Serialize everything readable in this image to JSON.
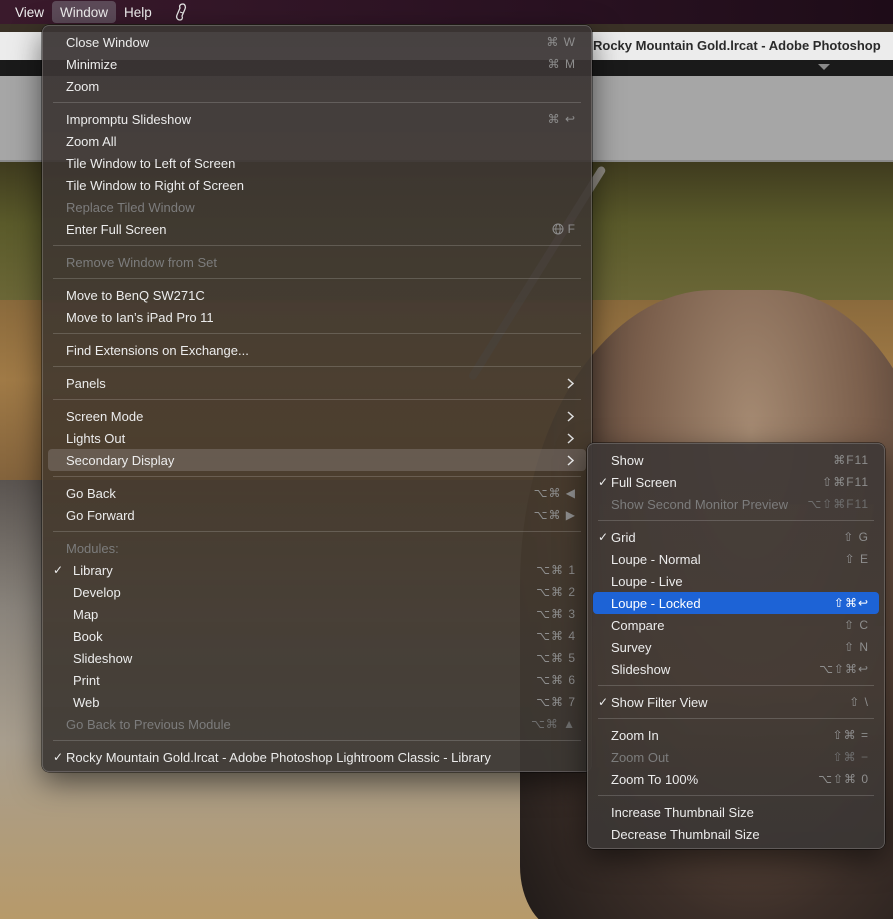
{
  "menubar": {
    "items": [
      {
        "label": "View"
      },
      {
        "label": "Window"
      },
      {
        "label": "Help"
      }
    ],
    "status_icon": "script-icon"
  },
  "window": {
    "title": "Rocky Mountain Gold.lrcat - Adobe Photoshop"
  },
  "window_menu": {
    "close_window": {
      "label": "Close Window",
      "shortcut": "⌘ W"
    },
    "minimize": {
      "label": "Minimize",
      "shortcut": "⌘ M"
    },
    "zoom": {
      "label": "Zoom"
    },
    "impromptu_slideshow": {
      "label": "Impromptu Slideshow",
      "shortcut": "⌘ ↩"
    },
    "zoom_all": {
      "label": "Zoom All"
    },
    "tile_left": {
      "label": "Tile Window to Left of Screen"
    },
    "tile_right": {
      "label": "Tile Window to Right of Screen"
    },
    "replace_tiled": {
      "label": "Replace Tiled Window"
    },
    "enter_full_screen": {
      "label": "Enter Full Screen",
      "shortcut": "F"
    },
    "remove_from_set": {
      "label": "Remove Window from Set"
    },
    "move_benq": {
      "label": "Move to BenQ SW271C"
    },
    "move_ipad": {
      "label": "Move to Ian’s iPad Pro 11"
    },
    "find_extensions": {
      "label": "Find Extensions on Exchange..."
    },
    "panels": {
      "label": "Panels"
    },
    "screen_mode": {
      "label": "Screen Mode"
    },
    "lights_out": {
      "label": "Lights Out"
    },
    "secondary_display": {
      "label": "Secondary Display"
    },
    "go_back": {
      "label": "Go Back",
      "shortcut": "⌥⌘ ◀"
    },
    "go_forward": {
      "label": "Go Forward",
      "shortcut": "⌥⌘ ▶"
    },
    "modules_header": {
      "label": "Modules:"
    },
    "modules": [
      {
        "label": "Library",
        "shortcut": "⌥⌘ 1",
        "checked": "✓"
      },
      {
        "label": "Develop",
        "shortcut": "⌥⌘ 2"
      },
      {
        "label": "Map",
        "shortcut": "⌥⌘ 3"
      },
      {
        "label": "Book",
        "shortcut": "⌥⌘ 4"
      },
      {
        "label": "Slideshow",
        "shortcut": "⌥⌘ 5"
      },
      {
        "label": "Print",
        "shortcut": "⌥⌘ 6"
      },
      {
        "label": "Web",
        "shortcut": "⌥⌘ 7"
      }
    ],
    "go_back_module": {
      "label": "Go Back to Previous Module",
      "shortcut": "⌥⌘ ▲"
    },
    "current_window": {
      "label": "Rocky Mountain Gold.lrcat - Adobe Photoshop Lightroom Classic - Library",
      "checked": "✓"
    }
  },
  "secondary_menu": {
    "show": {
      "label": "Show",
      "shortcut": "⌘F11"
    },
    "full_screen": {
      "label": "Full Screen",
      "shortcut": "⇧⌘F11",
      "checked": "✓"
    },
    "show_second_monitor_preview": {
      "label": "Show Second Monitor Preview",
      "shortcut": "⌥⇧⌘F11"
    },
    "grid": {
      "label": "Grid",
      "shortcut": "⇧ G",
      "checked": "✓"
    },
    "loupe_normal": {
      "label": "Loupe - Normal",
      "shortcut": "⇧ E"
    },
    "loupe_live": {
      "label": "Loupe - Live"
    },
    "loupe_locked": {
      "label": "Loupe - Locked",
      "shortcut": "⇧⌘↩"
    },
    "compare": {
      "label": "Compare",
      "shortcut": "⇧ C"
    },
    "survey": {
      "label": "Survey",
      "shortcut": "⇧ N"
    },
    "slideshow": {
      "label": "Slideshow",
      "shortcut": "⌥⇧⌘↩"
    },
    "show_filter_view": {
      "label": "Show Filter View",
      "shortcut": "⇧ \\",
      "checked": "✓"
    },
    "zoom_in": {
      "label": "Zoom In",
      "shortcut": "⇧⌘ ="
    },
    "zoom_out": {
      "label": "Zoom Out",
      "shortcut": "⇧⌘ −"
    },
    "zoom_100": {
      "label": "Zoom To 100%",
      "shortcut": "⌥⇧⌘ 0"
    },
    "increase_thumb": {
      "label": "Increase Thumbnail Size"
    },
    "decrease_thumb": {
      "label": "Decrease Thumbnail Size"
    }
  },
  "colors": {
    "highlight": "#1d63d6",
    "menubar_bg": "#2a1222",
    "menu_bg": "#3c3634"
  }
}
